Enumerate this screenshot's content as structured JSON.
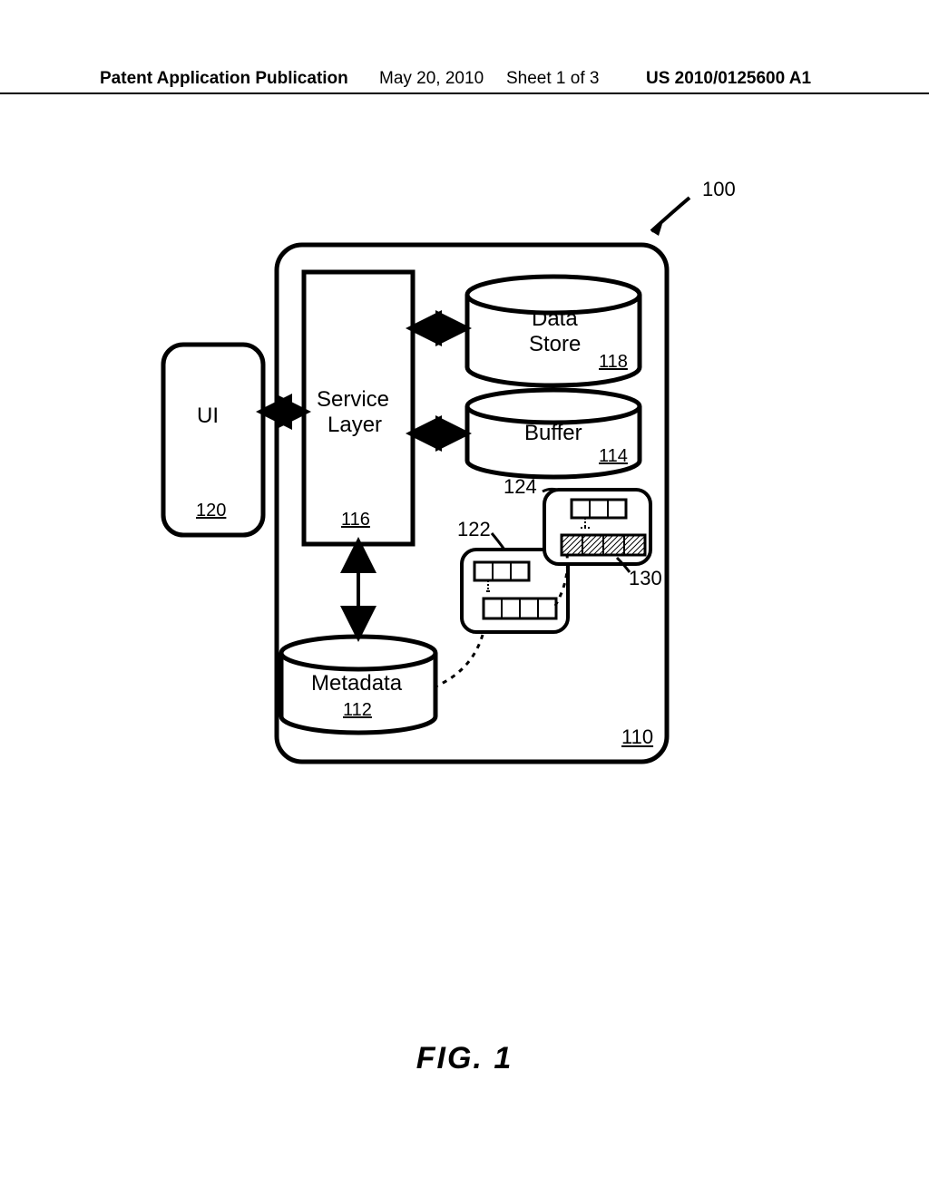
{
  "header": {
    "publication": "Patent Application Publication",
    "date": "May 20, 2010",
    "sheet": "Sheet 1 of 3",
    "pub_number": "US 2010/0125600 A1"
  },
  "diagram": {
    "system_ref": "100",
    "container_ref": "110",
    "metadata": {
      "label": "Metadata",
      "ref": "112"
    },
    "buffer": {
      "label": "Buffer",
      "ref": "114"
    },
    "service_layer": {
      "label_line1": "Service",
      "label_line2": "Layer",
      "ref": "116"
    },
    "data_store": {
      "label_line1": "Data",
      "label_line2": "Store",
      "ref": "118"
    },
    "ui": {
      "label": "UI",
      "ref": "120"
    },
    "module_a_ref": "122",
    "module_b_ref": "124",
    "element_ref": "130"
  },
  "figure_caption": "FIG.  1"
}
